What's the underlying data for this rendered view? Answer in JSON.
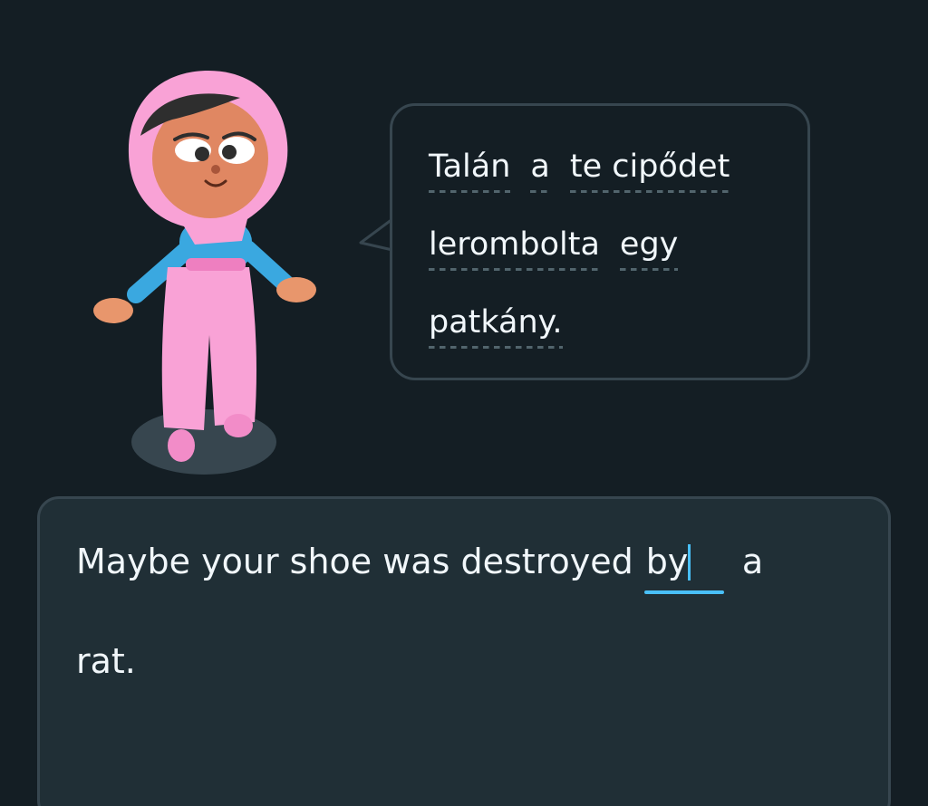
{
  "prompt": {
    "hint_words_line1": [
      "Talán",
      "a",
      "te cipődet"
    ],
    "hint_words_line2": [
      "lerombolta",
      "egy"
    ],
    "hint_words_line3": [
      "patkány."
    ]
  },
  "answer": {
    "before_blank": "Maybe your shoe was destroyed ",
    "blank_value": "by",
    "after_blank": " a",
    "second_line": "rat."
  },
  "colors": {
    "background": "#141e24",
    "panel": "#202f36",
    "border": "#37464f",
    "accent_blue": "#49c0f8",
    "text": "#f1f7fb"
  },
  "icons": {
    "character": "character-illustration-pink-hijab"
  }
}
